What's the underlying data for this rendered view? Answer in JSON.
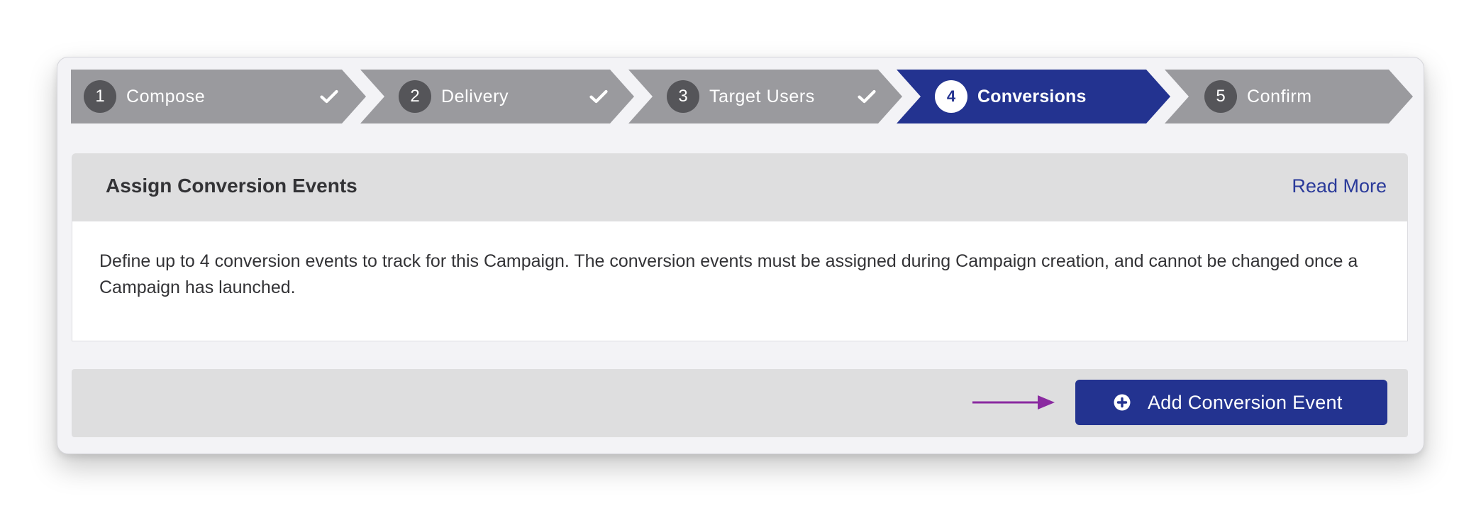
{
  "wizard": {
    "steps": [
      {
        "number": "1",
        "label": "Compose",
        "state": "complete"
      },
      {
        "number": "2",
        "label": "Delivery",
        "state": "complete"
      },
      {
        "number": "3",
        "label": "Target Users",
        "state": "complete"
      },
      {
        "number": "4",
        "label": "Conversions",
        "state": "active"
      },
      {
        "number": "5",
        "label": "Confirm",
        "state": "upcoming"
      }
    ]
  },
  "panel": {
    "title": "Assign Conversion Events",
    "read_more": "Read More",
    "description": "Define up to 4 conversion events to track for this Campaign. The conversion events must be assigned during Campaign creation, and cannot be changed once a Campaign has launched."
  },
  "footer": {
    "add_button_label": "Add Conversion Event",
    "add_button_icon": "plus-circle-icon",
    "pointer_arrow_icon": "arrow-right-icon"
  },
  "colors": {
    "active_step": "#233390",
    "inactive_step": "#9a9a9e",
    "step_number_bg": "#555559",
    "link": "#2a3a9a",
    "arrow": "#8a2aa0",
    "header_bg": "#dededf",
    "card_bg": "#f3f3f6"
  }
}
